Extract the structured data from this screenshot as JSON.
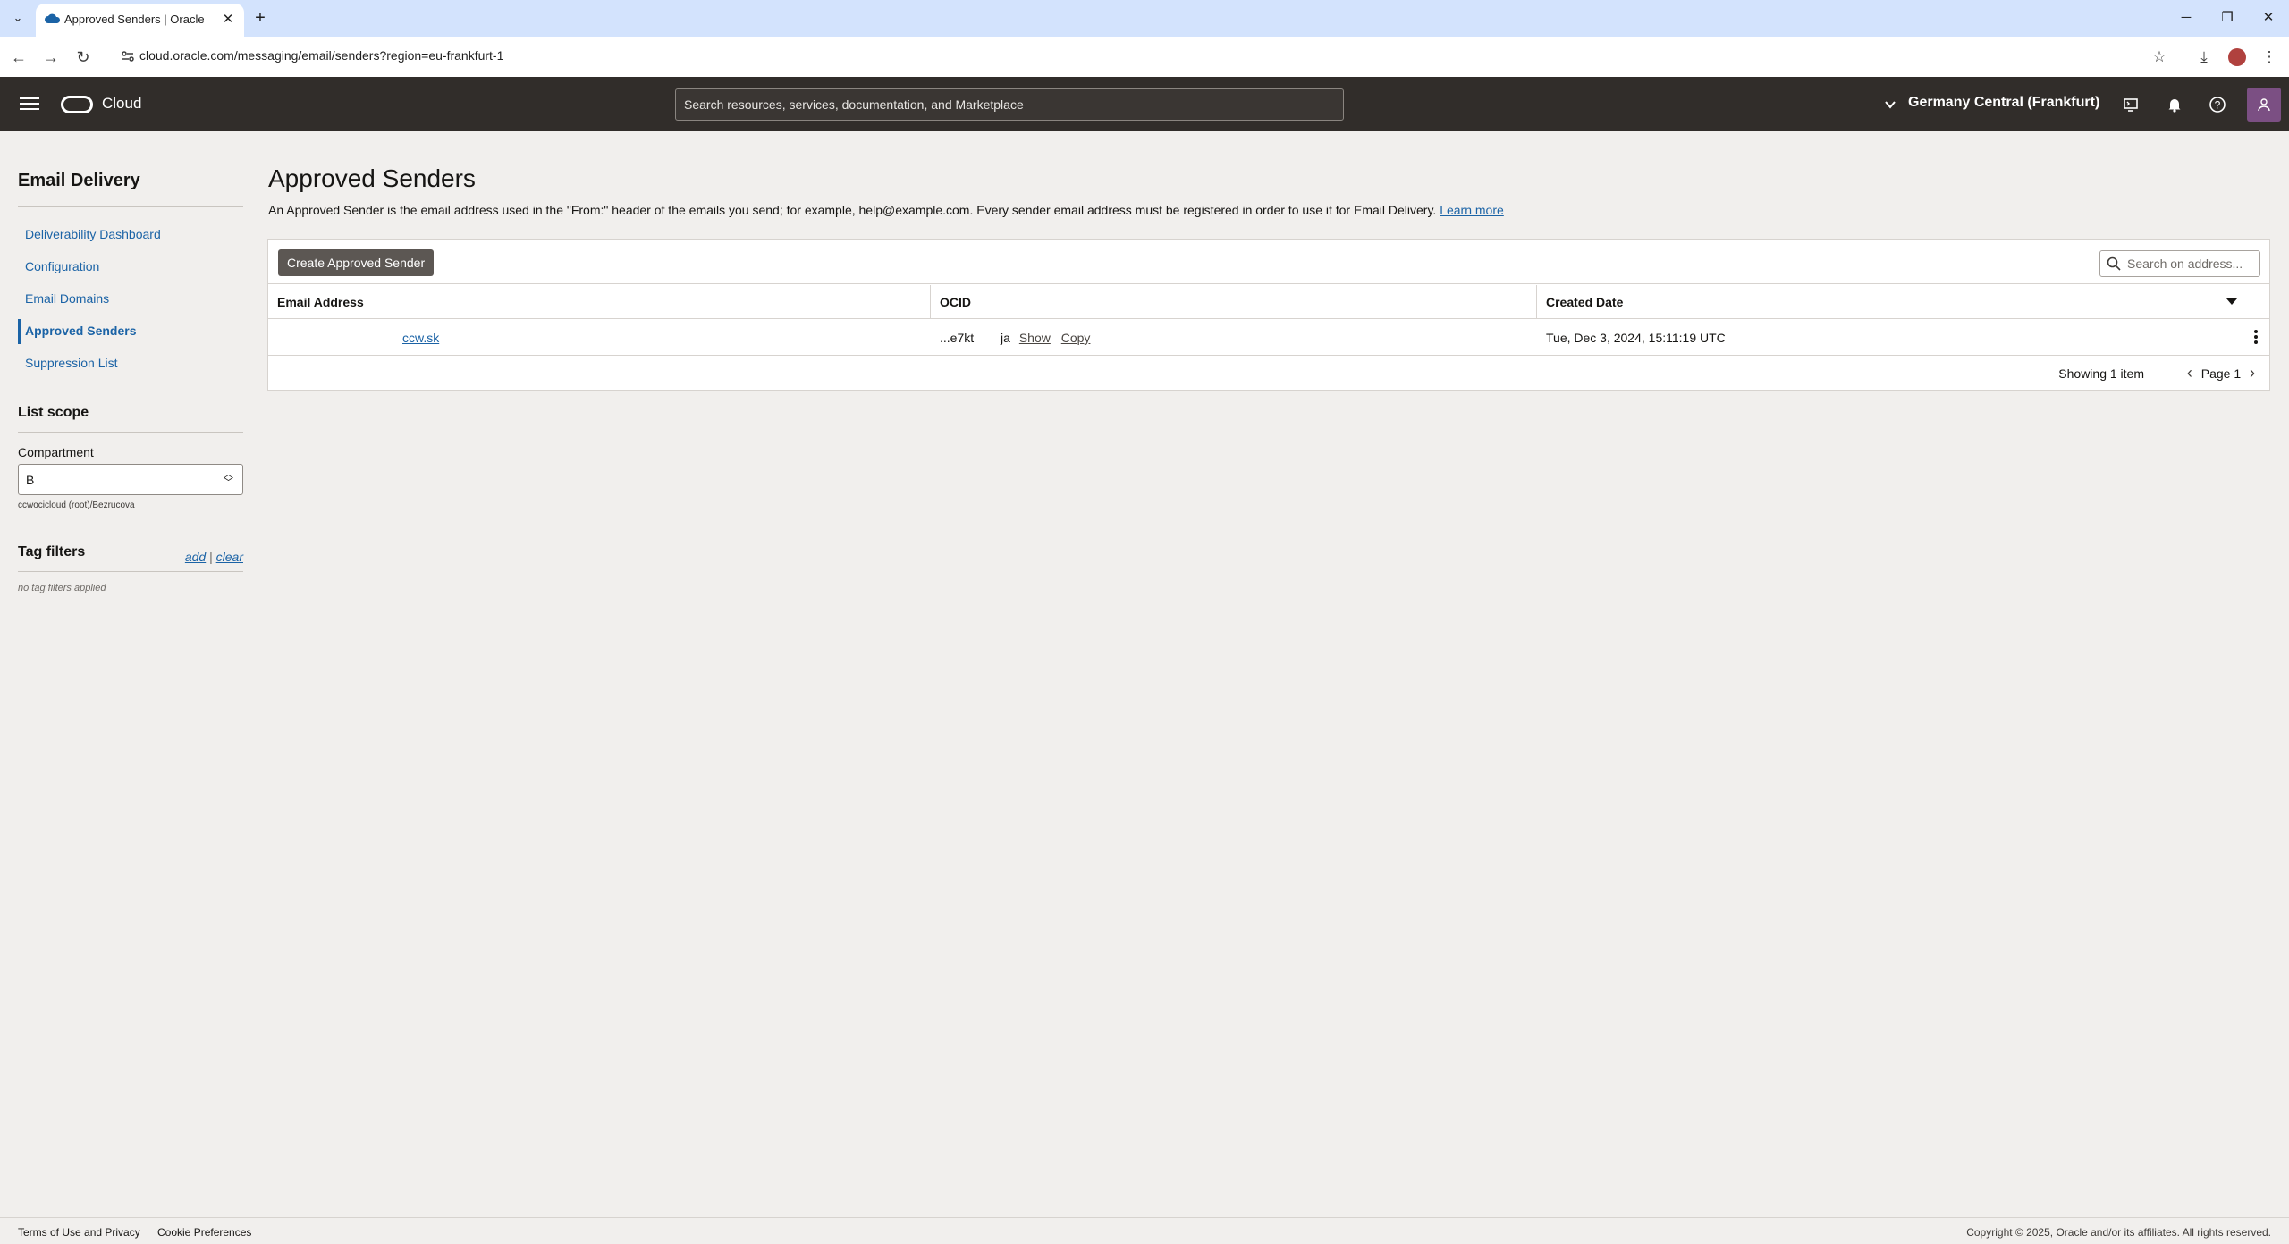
{
  "browser": {
    "tab_title": "Approved Senders | Oracle Clo",
    "url": "cloud.oracle.com/messaging/email/senders?region=eu-frankfurt-1",
    "new_tab_symbol": "+",
    "close_symbol": "✕"
  },
  "header": {
    "brand": "Cloud",
    "search_placeholder": "Search resources, services, documentation, and Marketplace",
    "region": "Germany Central (Frankfurt)"
  },
  "sidebar": {
    "title": "Email Delivery",
    "items": [
      {
        "label": "Deliverability Dashboard",
        "active": false
      },
      {
        "label": "Configuration",
        "active": false
      },
      {
        "label": "Email Domains",
        "active": false
      },
      {
        "label": "Approved Senders",
        "active": true
      },
      {
        "label": "Suppression List",
        "active": false
      }
    ],
    "list_scope_title": "List scope",
    "compartment_label": "Compartment",
    "compartment_value": "B",
    "compartment_path": "ccwocicloud (root)/Bezrucova",
    "tag_filters_title": "Tag filters",
    "tag_add": "add",
    "tag_separator": "|",
    "tag_clear": "clear",
    "no_tags": "no tag filters applied"
  },
  "main": {
    "title": "Approved Senders",
    "description": "An Approved Sender is the email address used in the \"From:\" header of the emails you send; for example, help@example.com. Every sender email address must be registered in order to use it for Email Delivery.",
    "learn_more": "Learn more",
    "create_button": "Create Approved Sender",
    "table_search_placeholder": "Search on address...",
    "columns": [
      "Email Address",
      "OCID",
      "Created Date"
    ],
    "rows": [
      {
        "email": "ccw.sk",
        "ocid_short": "...e7kt",
        "ocid_tail": "ja",
        "show": "Show",
        "copy": "Copy",
        "created": "Tue, Dec 3, 2024, 15:11:19 UTC"
      }
    ],
    "showing": "Showing 1 item",
    "page": "Page 1"
  },
  "footer": {
    "terms": "Terms of Use and Privacy",
    "cookies": "Cookie Preferences",
    "copyright": "Copyright © 2025, Oracle and/or its affiliates. All rights reserved."
  },
  "colors": {
    "header_bg": "#312d2a",
    "link": "#1b63a6",
    "page_bg": "#f1efed",
    "avatar": "#7b4f83"
  }
}
